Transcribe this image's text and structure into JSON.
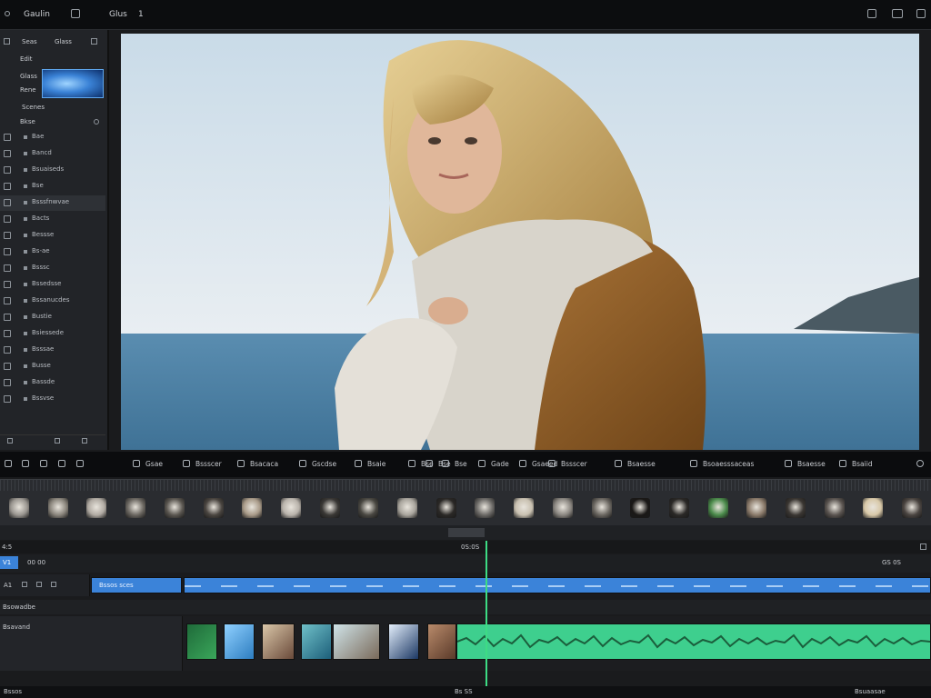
{
  "topbar": {
    "app_title": "Gaulin",
    "menu_item": "Glus",
    "counter": "1"
  },
  "sidebar": {
    "header_left": "Seas",
    "header_right": "Glass",
    "row_a": "Edit",
    "row_b": "Glass",
    "row_c": "Rene",
    "section_label": "Scenes",
    "sub_label": "Bkse",
    "items": [
      {
        "label": "Bae"
      },
      {
        "label": "Bancd"
      },
      {
        "label": "Bsuaiseds"
      },
      {
        "label": "Bse"
      },
      {
        "label": "Bsssfnwvae"
      },
      {
        "label": "Bacts"
      },
      {
        "label": "Bessse"
      },
      {
        "label": "Bs-ae"
      },
      {
        "label": "Bsssc"
      },
      {
        "label": "Bssedsse"
      },
      {
        "label": "Bssanucdes"
      },
      {
        "label": "Bustie"
      },
      {
        "label": "Bsiessede"
      },
      {
        "label": "Bsssae"
      },
      {
        "label": "Busse"
      },
      {
        "label": "Bassde"
      },
      {
        "label": "Bssvse"
      }
    ]
  },
  "controls": {
    "items": [
      {
        "label": "Gsae"
      },
      {
        "label": "Bssscer"
      },
      {
        "label": "Bsacaca"
      },
      {
        "label": "Gscdse"
      },
      {
        "label": "Bsaie"
      },
      {
        "label": "Bse"
      },
      {
        "label": "Bse"
      },
      {
        "label": "Bse"
      },
      {
        "label": "Gade"
      },
      {
        "label": "Gsaeed"
      },
      {
        "label": "Bssscer"
      },
      {
        "label": "Bsaesse"
      },
      {
        "label": "Bsoaesssaceas"
      },
      {
        "label": "Bsaesse"
      },
      {
        "label": "Bsaiid"
      }
    ]
  },
  "timeline": {
    "timecode": "0:00:00:00",
    "zoom": "4:5",
    "track_labels": [
      "V1",
      "A1",
      "Bsowadbe",
      "Bsavand"
    ],
    "track_num": "00 00",
    "clip_label": "Bssos sces",
    "end_label": "GS 0S",
    "ruler_label": "0S:0S",
    "status_left": "Bssos",
    "status_mid": "Bs SS",
    "status_right": "Bsuaasae"
  },
  "colors": {
    "accent_blue": "#3b83d9",
    "audio_green": "#3ecf8e",
    "playhead": "#3ddc84"
  }
}
